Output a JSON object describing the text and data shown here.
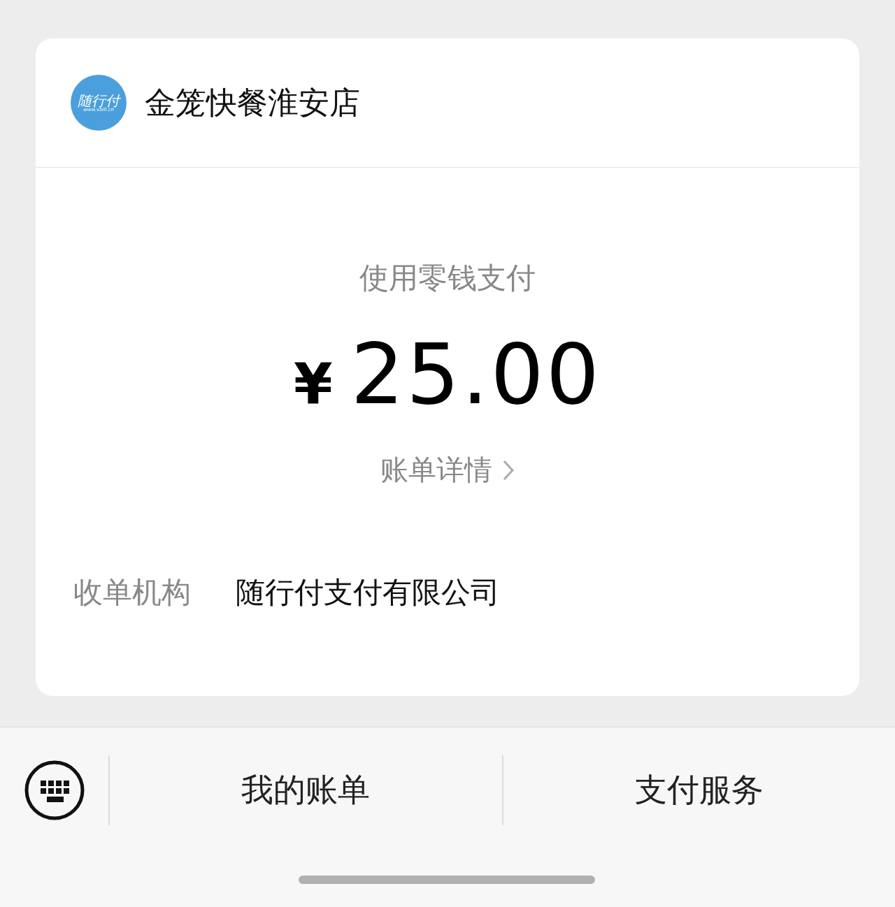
{
  "merchant": {
    "logo_text": "随行付",
    "logo_url": "www.vbill.cn",
    "name": "金笼快餐淮安店"
  },
  "payment": {
    "method": "使用零钱支付",
    "currency": "¥",
    "amount": "25.00",
    "details_link": "账单详情"
  },
  "info": [
    {
      "label": "收单机构",
      "value": "随行付支付有限公司"
    }
  ],
  "menu_bar": {
    "items": [
      "我的账单",
      "支付服务"
    ]
  }
}
